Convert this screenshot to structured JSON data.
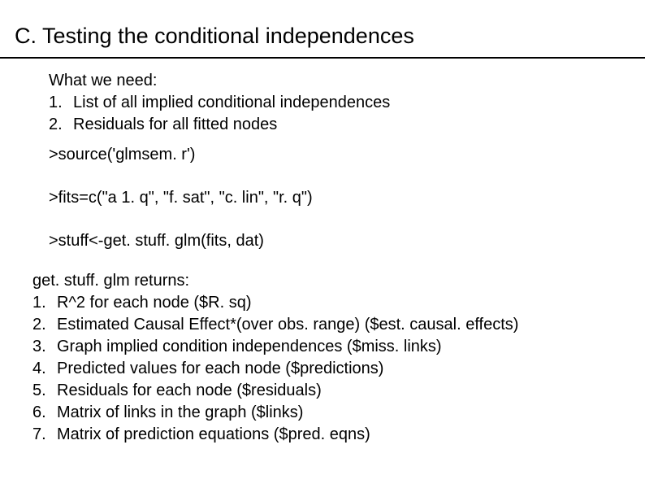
{
  "title": "C. Testing the conditional independences",
  "need": {
    "heading": "What we need:",
    "items": [
      {
        "num": "1.",
        "text": "List of all implied conditional independences"
      },
      {
        "num": "2.",
        "text": "Residuals for all fitted nodes"
      }
    ]
  },
  "code": {
    "line1": ">source('glmsem. r')",
    "line2": ">fits=c(\"a 1. q\", \"f. sat\", \"c. lin\", \"r. q\")",
    "line3": ">stuff<-get. stuff. glm(fits, dat)"
  },
  "returns": {
    "heading": "get. stuff. glm returns:",
    "items": [
      {
        "num": "1.",
        "text": "R^2 for each node ($R. sq)"
      },
      {
        "num": "2.",
        "text": "Estimated Causal Effect*(over obs. range) ($est. causal. effects)"
      },
      {
        "num": "3.",
        "text": "Graph implied condition independences ($miss. links)"
      },
      {
        "num": "4.",
        "text": "Predicted values for each node ($predictions)"
      },
      {
        "num": "5.",
        "text": "Residuals for each node ($residuals)"
      },
      {
        "num": "6.",
        "text": "Matrix of links in the graph ($links)"
      },
      {
        "num": "7.",
        "text": "Matrix of prediction equations ($pred. eqns)"
      }
    ]
  }
}
